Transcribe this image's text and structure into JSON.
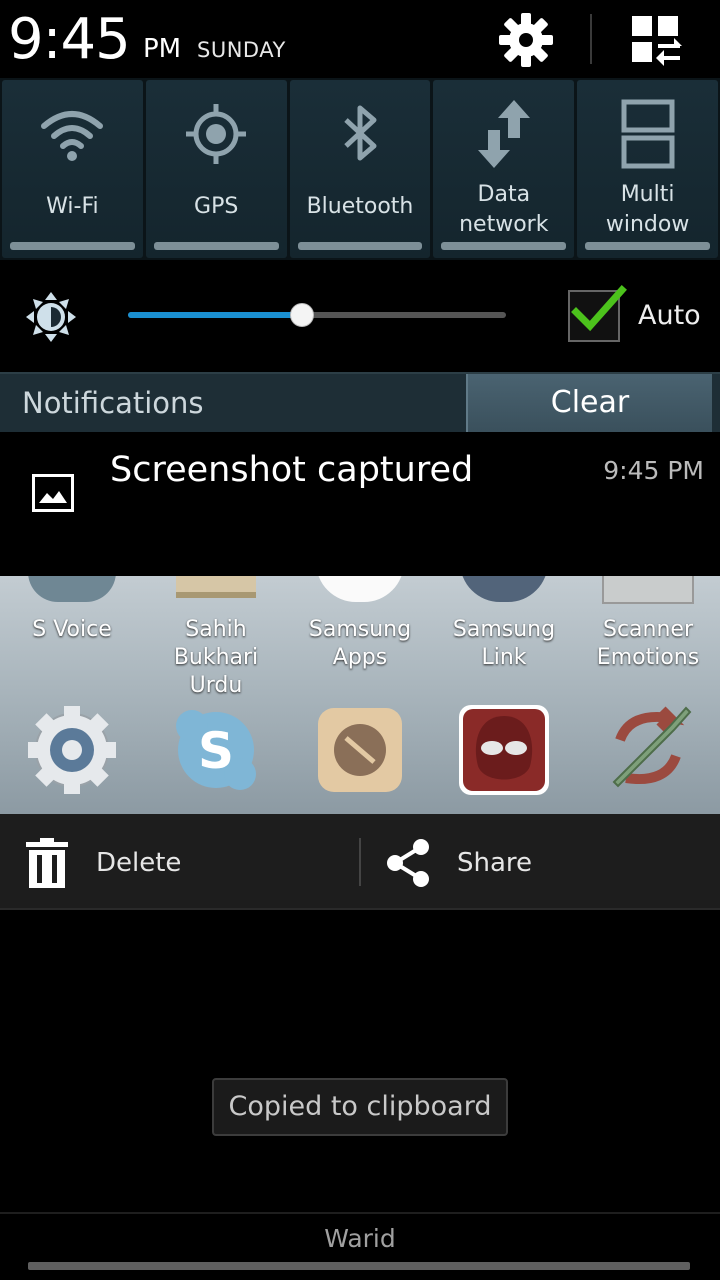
{
  "header": {
    "time": "9:45",
    "ampm": "PM",
    "day": "SUNDAY",
    "settings_icon": "gear-icon",
    "quick_panel_icon": "grid-swap-icon"
  },
  "toggles": [
    {
      "label": "Wi-Fi",
      "icon": "wifi-icon"
    },
    {
      "label": "GPS",
      "icon": "gps-icon"
    },
    {
      "label": "Bluetooth",
      "icon": "bluetooth-icon"
    },
    {
      "label_line1": "Data",
      "label_line2": "network",
      "icon": "data-network-icon"
    },
    {
      "label_line1": "Multi",
      "label_line2": "window",
      "icon": "multi-window-icon"
    }
  ],
  "brightness": {
    "level": 0.46,
    "auto_checked": true,
    "auto_label": "Auto",
    "fill_color": "#1a8fd0"
  },
  "notifications": {
    "title": "Notifications",
    "clear_label": "Clear"
  },
  "notification_item": {
    "title": "Screenshot captured",
    "time": "9:45 PM",
    "icon": "image-icon"
  },
  "preview": {
    "row1": [
      {
        "line1": "S Voice",
        "line2": ""
      },
      {
        "line1": "Sahih",
        "line2": "Bukhari Urdu"
      },
      {
        "line1": "Samsung",
        "line2": "Apps"
      },
      {
        "line1": "Samsung",
        "line2": "Link"
      },
      {
        "line1": "Scanner",
        "line2": "Emotions"
      }
    ],
    "row2_icons": [
      "settings-gear-icon",
      "skype-icon",
      "soundhound-icon",
      "spiderman-icon",
      "spin-bottle-icon"
    ]
  },
  "actions": {
    "delete_label": "Delete",
    "share_label": "Share"
  },
  "toast": {
    "text": "Copied to clipboard"
  },
  "footer": {
    "carrier": "Warid"
  }
}
